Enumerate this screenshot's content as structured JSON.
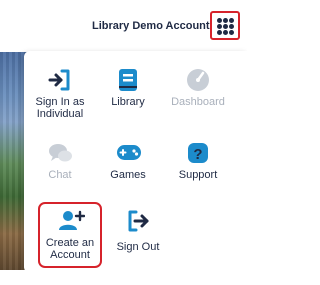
{
  "header": {
    "account_label": "Library Demo Account"
  },
  "menu": {
    "items": [
      {
        "label": "Sign In as\nIndividual",
        "icon": "sign-in-icon",
        "enabled": true
      },
      {
        "label": "Library",
        "icon": "book-icon",
        "enabled": true
      },
      {
        "label": "Dashboard",
        "icon": "gauge-icon",
        "enabled": false
      },
      {
        "label": "Chat",
        "icon": "chat-bubbles-icon",
        "enabled": false
      },
      {
        "label": "Games",
        "icon": "gamepad-icon",
        "enabled": true
      },
      {
        "label": "Support",
        "icon": "question-icon",
        "enabled": true
      },
      {
        "label": "Create an\nAccount",
        "icon": "add-user-icon",
        "enabled": true
      },
      {
        "label": "Sign Out",
        "icon": "sign-out-icon",
        "enabled": true
      }
    ]
  },
  "colors": {
    "accent_blue": "#1c8bcb",
    "navy_text": "#1f2a44",
    "disabled_gray": "#b9c0ca",
    "highlight_red": "#d6232b"
  }
}
